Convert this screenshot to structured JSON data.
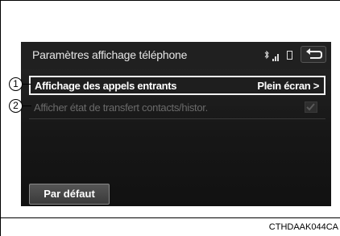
{
  "screen": {
    "title": "Paramètres affichage téléphone",
    "status_icons": [
      "bluetooth-icon",
      "signal-icon",
      "battery-icon"
    ],
    "back_icon": "back-arrow-icon"
  },
  "rows": [
    {
      "callout": "1",
      "label": "Affichage des appels entrants",
      "value": "Plein écran >"
    },
    {
      "callout": "2",
      "label": "Afficher état de transfert contacts/histor.",
      "checkbox": "checked-disabled"
    }
  ],
  "buttons": {
    "default_label": "Par défaut"
  },
  "figure_code": "CTHDAAK044CA"
}
